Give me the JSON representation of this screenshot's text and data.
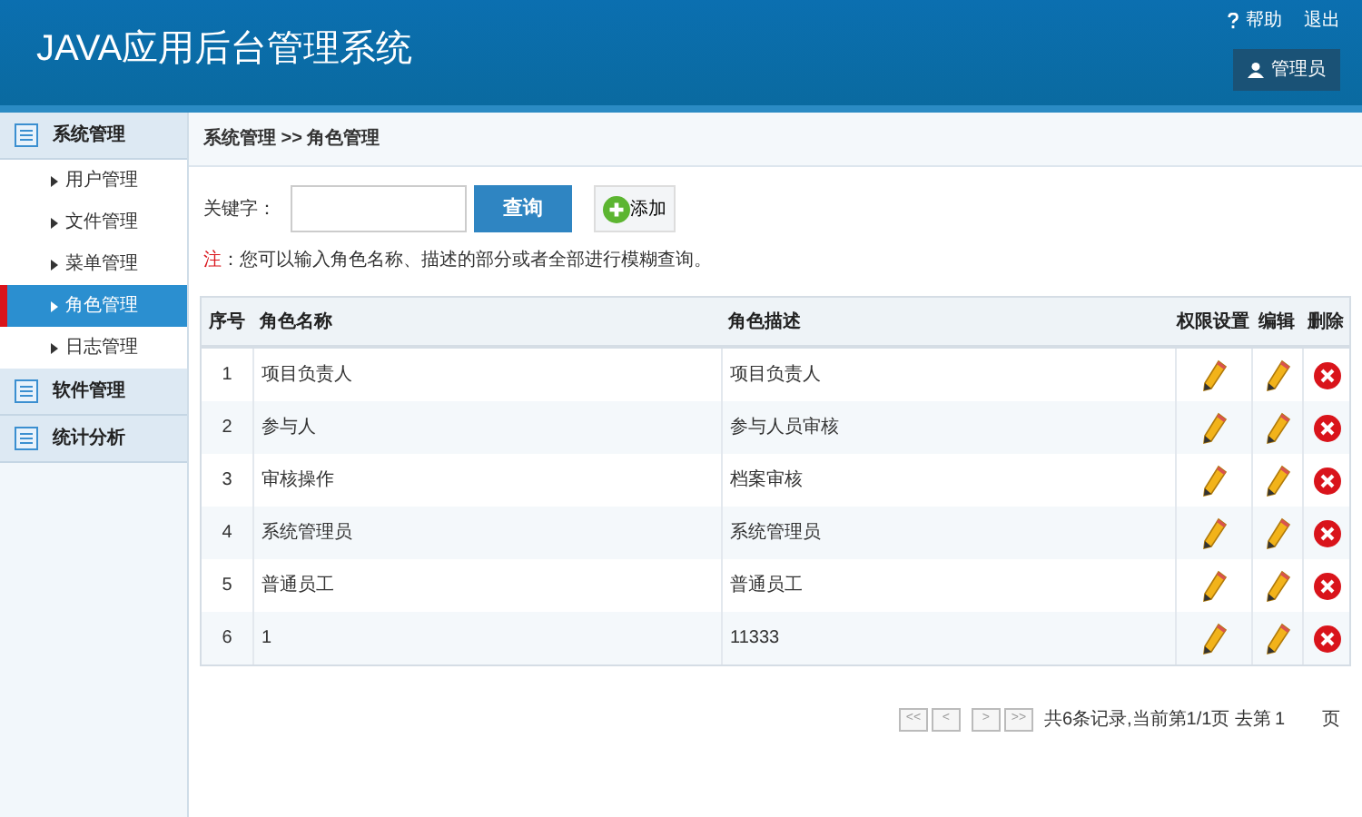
{
  "header": {
    "title": "JAVA应用后台管理系统",
    "links": [
      {
        "kind": "help",
        "label": "帮助"
      },
      {
        "kind": "logout",
        "label": "退出"
      }
    ],
    "user": "管理员"
  },
  "sidebar": {
    "groups": [
      {
        "label": "系统管理",
        "children": [
          {
            "label": "用户管理",
            "selected": false
          },
          {
            "label": "文件管理",
            "selected": false
          },
          {
            "label": "菜单管理",
            "selected": false
          },
          {
            "label": "角色管理",
            "selected": true
          },
          {
            "label": "日志管理",
            "selected": false
          }
        ]
      },
      {
        "label": "软件管理"
      },
      {
        "label": "统计分析"
      }
    ]
  },
  "breadcrumb": "系统管理 >> 角色管理",
  "search": {
    "label": "关键字：",
    "button": "查询",
    "add_button": "添加",
    "note_mark": "注",
    "note": "：您可以输入角色名称、描述的部分或者全部进行模糊查询。"
  },
  "table": {
    "columns": [
      "序号",
      "角色名称",
      "角色描述",
      "权限设置",
      "编辑",
      "删除"
    ],
    "rows": [
      {
        "index": "1",
        "name": "项目负责人",
        "description": "项目负责人"
      },
      {
        "index": "2",
        "name": "参与人",
        "description": "参与人员审核"
      },
      {
        "index": "3",
        "name": "审核操作",
        "description": "档案审核"
      },
      {
        "index": "4",
        "name": "系统管理员",
        "description": "系统管理员"
      },
      {
        "index": "5",
        "name": "普通员工",
        "description": "普通员工"
      },
      {
        "index": "6",
        "name": "1",
        "description": "11333"
      }
    ]
  },
  "pagination": {
    "buttons": [
      "<<",
      "<",
      ">",
      ">>"
    ],
    "info": "共6条记录,当前第1/1页 去第",
    "page_value": "1",
    "suffix": "页"
  }
}
